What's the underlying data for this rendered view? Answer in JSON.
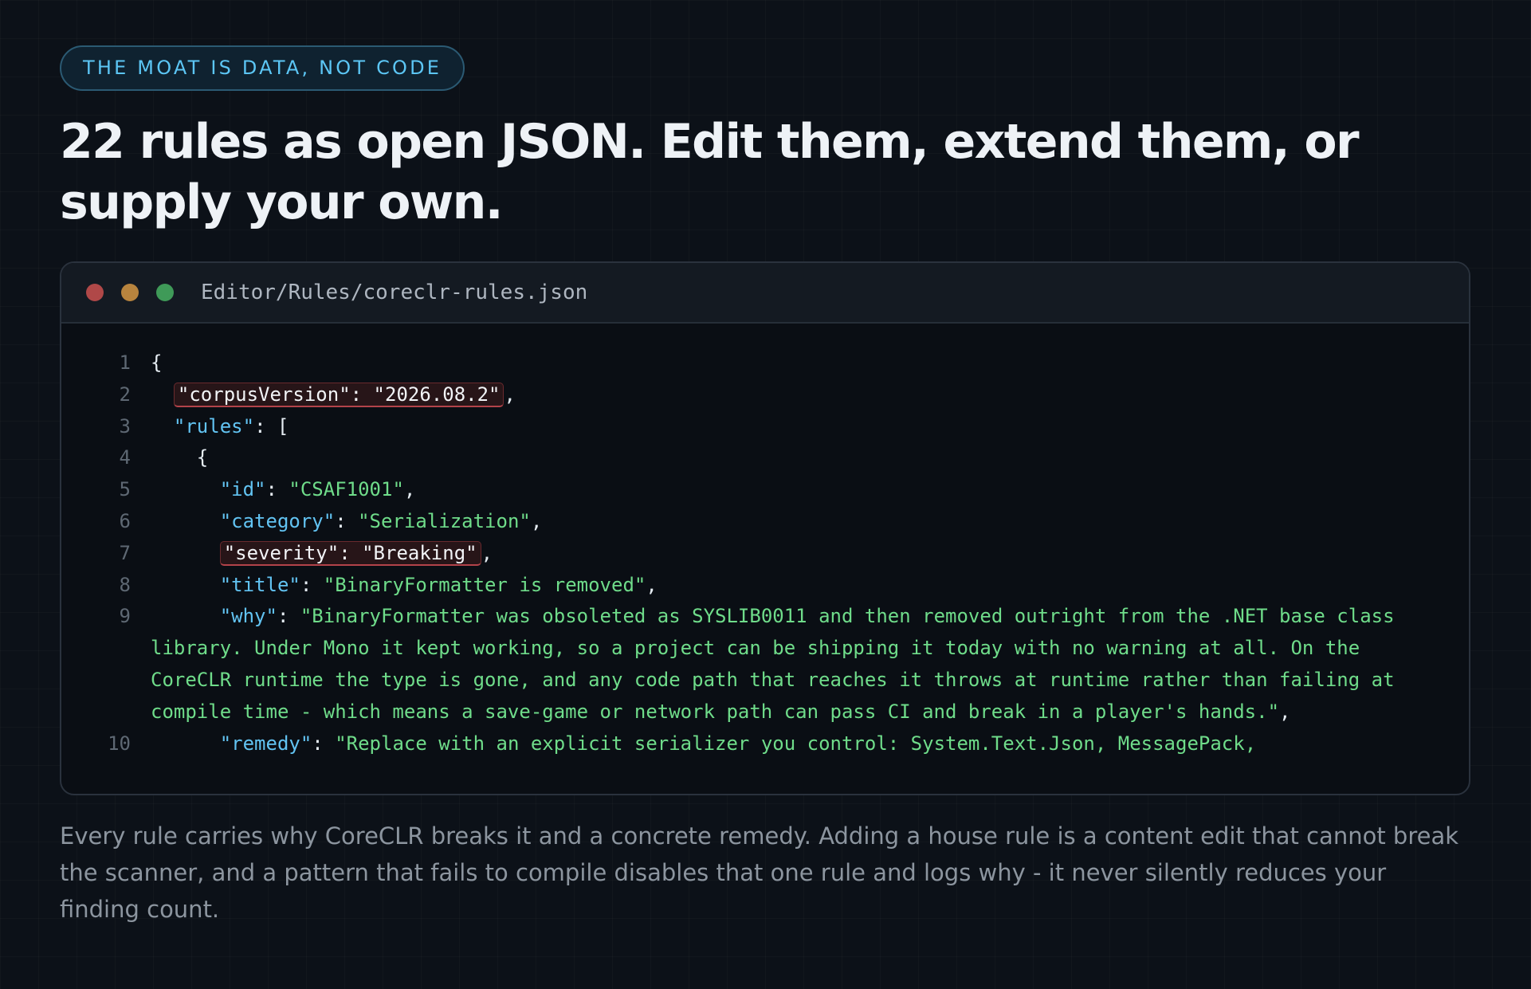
{
  "eyebrow": "THE MOAT IS DATA, NOT CODE",
  "headline": "22 rules as open JSON. Edit them, extend them, or supply your own.",
  "editor": {
    "file_path": "Editor/Rules/coreclr-rules.json",
    "lines": [
      {
        "n": "1",
        "open_brace": "{"
      },
      {
        "n": "2",
        "corpus_version": "\"corpusVersion\": \"2026.08.2\"",
        "comma": ","
      },
      {
        "n": "3",
        "key": "\"rules\"",
        "tail": ": ["
      },
      {
        "n": "4",
        "open_brace": "{"
      },
      {
        "n": "5",
        "key": "\"id\"",
        "sep": ": ",
        "value": "\"CSAF1001\"",
        "comma": ","
      },
      {
        "n": "6",
        "key": "\"category\"",
        "sep": ": ",
        "value": "\"Serialization\"",
        "comma": ","
      },
      {
        "n": "7",
        "severity": "\"severity\": \"Breaking\"",
        "comma": ","
      },
      {
        "n": "8",
        "key": "\"title\"",
        "sep": ": ",
        "value": "\"BinaryFormatter is removed\"",
        "comma": ","
      },
      {
        "n": "9",
        "key": "\"why\"",
        "sep": ": ",
        "value": "\"BinaryFormatter was obsoleted as SYSLIB0011 and then removed outright from the .NET base class library. Under Mono it kept working, so a project can be shipping it today with no warning at all. On the CoreCLR runtime the type is gone, and any code path that reaches it throws at runtime rather than failing at compile time - which means a save-game or network path can pass CI and break in a player's hands.\"",
        "comma": ","
      },
      {
        "n": "10",
        "key": "\"remedy\"",
        "sep": ": ",
        "value": "\"Replace with an explicit serializer you control: System.Text.Json, MessagePack,"
      }
    ]
  },
  "caption": "Every rule carries why CoreCLR breaks it and a concrete remedy. Adding a house rule is a content edit that cannot break the scanner, and a pattern that fails to compile disables that one rule and logs why - it never silently reduces your finding count.",
  "colors": {
    "background": "#0c1118",
    "eyebrow_text": "#5cc6f5",
    "json_key": "#62c3f2",
    "json_string": "#6fdc8a",
    "highlight_underline": "#b3434a",
    "traffic_red": "#b04848",
    "traffic_yellow": "#b8843e",
    "traffic_green": "#3f9a58"
  }
}
